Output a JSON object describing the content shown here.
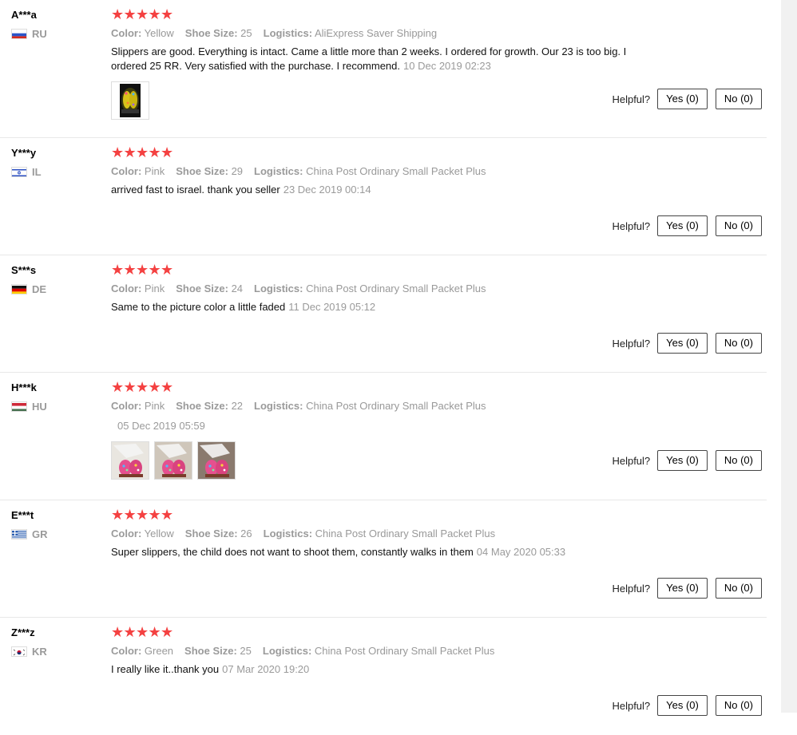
{
  "reviews": [
    {
      "user": "A***a",
      "country": "RU",
      "flag": "ru",
      "attributes": [
        {
          "key": "Color:",
          "value": "Yellow"
        },
        {
          "key": "Shoe Size:",
          "value": "25"
        },
        {
          "key": "Logistics:",
          "value": "AliExpress Saver Shipping"
        }
      ],
      "text": "Slippers are good. Everything is intact. Came a little more than 2 weeks. I ordered for growth. Our 23 is too big. I ordered 25 RR. Very satisfied with the purchase. I recommend.",
      "date": "10 Dec 2019 02:23",
      "photos": 1,
      "helpful_label": "Helpful?",
      "yes": "Yes (0)",
      "no": "No (0)"
    },
    {
      "user": "Y***y",
      "country": "IL",
      "flag": "il",
      "attributes": [
        {
          "key": "Color:",
          "value": "Pink"
        },
        {
          "key": "Shoe Size:",
          "value": "29"
        },
        {
          "key": "Logistics:",
          "value": "China Post Ordinary Small Packet Plus"
        }
      ],
      "text": "arrived fast to israel. thank you seller",
      "date": "23 Dec 2019 00:14",
      "photos": 0,
      "helpful_label": "Helpful?",
      "yes": "Yes (0)",
      "no": "No (0)"
    },
    {
      "user": "S***s",
      "country": "DE",
      "flag": "de",
      "attributes": [
        {
          "key": "Color:",
          "value": "Pink"
        },
        {
          "key": "Shoe Size:",
          "value": "24"
        },
        {
          "key": "Logistics:",
          "value": "China Post Ordinary Small Packet Plus"
        }
      ],
      "text": "Same to the picture color a little faded",
      "date": "11 Dec 2019 05:12",
      "photos": 0,
      "helpful_label": "Helpful?",
      "yes": "Yes (0)",
      "no": "No (0)"
    },
    {
      "user": "H***k",
      "country": "HU",
      "flag": "hu",
      "attributes": [
        {
          "key": "Color:",
          "value": "Pink"
        },
        {
          "key": "Shoe Size:",
          "value": "22"
        },
        {
          "key": "Logistics:",
          "value": "China Post Ordinary Small Packet Plus"
        }
      ],
      "text": "",
      "date": "05 Dec 2019 05:59",
      "photos": 3,
      "helpful_label": "Helpful?",
      "yes": "Yes (0)",
      "no": "No (0)"
    },
    {
      "user": "E***t",
      "country": "GR",
      "flag": "gr",
      "attributes": [
        {
          "key": "Color:",
          "value": "Yellow"
        },
        {
          "key": "Shoe Size:",
          "value": "26"
        },
        {
          "key": "Logistics:",
          "value": "China Post Ordinary Small Packet Plus"
        }
      ],
      "text": "Super slippers, the child does not want to shoot them, constantly walks in them",
      "date": "04 May 2020 05:33",
      "photos": 0,
      "helpful_label": "Helpful?",
      "yes": "Yes (0)",
      "no": "No (0)"
    },
    {
      "user": "Z***z",
      "country": "KR",
      "flag": "kr",
      "attributes": [
        {
          "key": "Color:",
          "value": "Green"
        },
        {
          "key": "Shoe Size:",
          "value": "25"
        },
        {
          "key": "Logistics:",
          "value": "China Post Ordinary Small Packet Plus"
        }
      ],
      "text": "I really like it..thank you",
      "date": "07 Mar 2020 19:20",
      "photos": 0,
      "helpful_label": "Helpful?",
      "yes": "Yes (0)",
      "no": "No (0)"
    }
  ],
  "star_color": "#f44141",
  "star_count": 5
}
